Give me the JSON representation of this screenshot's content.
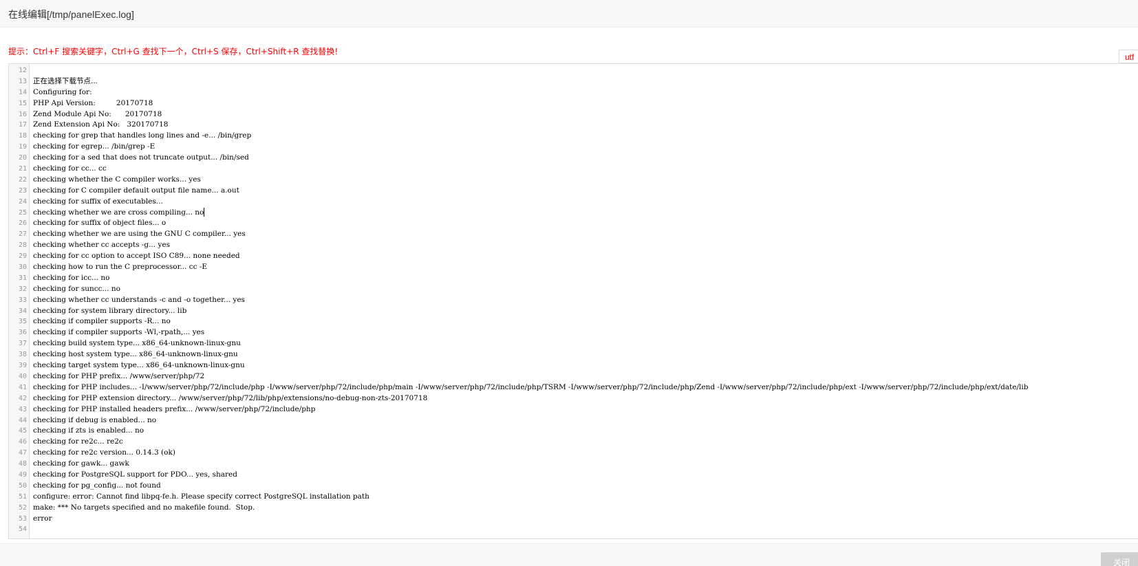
{
  "window": {
    "title": "在线编辑[/tmp/panelExec.log]"
  },
  "hint": "提示：Ctrl+F 搜索关键字，Ctrl+G 查找下一个，Ctrl+S 保存，Ctrl+Shift+R 查找替换!",
  "encoding": {
    "selected": "utf"
  },
  "editor": {
    "cursor_line": 25,
    "lines": [
      {
        "n": "12",
        "text": ""
      },
      {
        "n": "13",
        "text": "正在选择下载节点..."
      },
      {
        "n": "14",
        "text": "Configuring for:"
      },
      {
        "n": "15",
        "text": "PHP Api Version:         20170718"
      },
      {
        "n": "16",
        "text": "Zend Module Api No:      20170718"
      },
      {
        "n": "17",
        "text": "Zend Extension Api No:   320170718"
      },
      {
        "n": "18",
        "text": "checking for grep that handles long lines and -e... /bin/grep"
      },
      {
        "n": "19",
        "text": "checking for egrep... /bin/grep -E"
      },
      {
        "n": "20",
        "text": "checking for a sed that does not truncate output... /bin/sed"
      },
      {
        "n": "21",
        "text": "checking for cc... cc"
      },
      {
        "n": "22",
        "text": "checking whether the C compiler works... yes"
      },
      {
        "n": "23",
        "text": "checking for C compiler default output file name... a.out"
      },
      {
        "n": "24",
        "text": "checking for suffix of executables..."
      },
      {
        "n": "25",
        "text": "checking whether we are cross compiling... no"
      },
      {
        "n": "26",
        "text": "checking for suffix of object files... o"
      },
      {
        "n": "27",
        "text": "checking whether we are using the GNU C compiler... yes"
      },
      {
        "n": "28",
        "text": "checking whether cc accepts -g... yes"
      },
      {
        "n": "29",
        "text": "checking for cc option to accept ISO C89... none needed"
      },
      {
        "n": "30",
        "text": "checking how to run the C preprocessor... cc -E"
      },
      {
        "n": "31",
        "text": "checking for icc... no"
      },
      {
        "n": "32",
        "text": "checking for suncc... no"
      },
      {
        "n": "33",
        "text": "checking whether cc understands -c and -o together... yes"
      },
      {
        "n": "34",
        "text": "checking for system library directory... lib"
      },
      {
        "n": "35",
        "text": "checking if compiler supports -R... no"
      },
      {
        "n": "36",
        "text": "checking if compiler supports -Wl,-rpath,... yes"
      },
      {
        "n": "37",
        "text": "checking build system type... x86_64-unknown-linux-gnu"
      },
      {
        "n": "38",
        "text": "checking host system type... x86_64-unknown-linux-gnu"
      },
      {
        "n": "39",
        "text": "checking target system type... x86_64-unknown-linux-gnu"
      },
      {
        "n": "40",
        "text": "checking for PHP prefix... /www/server/php/72"
      },
      {
        "n": "41",
        "text": "checking for PHP includes... -I/www/server/php/72/include/php -I/www/server/php/72/include/php/main -I/www/server/php/72/include/php/TSRM -I/www/server/php/72/include/php/Zend -I/www/server/php/72/include/php/ext -I/www/server/php/72/include/php/ext/date/lib"
      },
      {
        "n": "42",
        "text": "checking for PHP extension directory... /www/server/php/72/lib/php/extensions/no-debug-non-zts-20170718"
      },
      {
        "n": "43",
        "text": "checking for PHP installed headers prefix... /www/server/php/72/include/php"
      },
      {
        "n": "44",
        "text": "checking if debug is enabled... no"
      },
      {
        "n": "45",
        "text": "checking if zts is enabled... no"
      },
      {
        "n": "46",
        "text": "checking for re2c... re2c"
      },
      {
        "n": "47",
        "text": "checking for re2c version... 0.14.3 (ok)"
      },
      {
        "n": "48",
        "text": "checking for gawk... gawk"
      },
      {
        "n": "49",
        "text": "checking for PostgreSQL support for PDO... yes, shared"
      },
      {
        "n": "50",
        "text": "checking for pg_config... not found"
      },
      {
        "n": "51",
        "text": "configure: error: Cannot find libpq-fe.h. Please specify correct PostgreSQL installation path"
      },
      {
        "n": "52",
        "text": "make: *** No targets specified and no makefile found.  Stop."
      },
      {
        "n": "53",
        "text": "error"
      },
      {
        "n": "54",
        "text": ""
      }
    ]
  },
  "footer": {
    "close_label": "关闭"
  }
}
